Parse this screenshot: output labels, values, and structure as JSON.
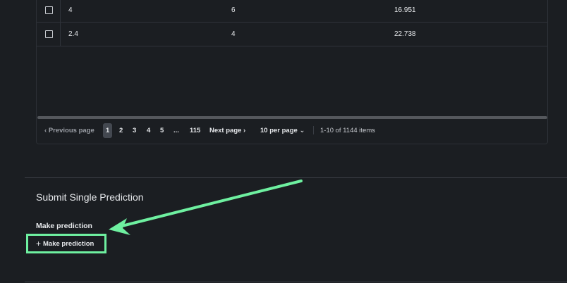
{
  "table": {
    "rows": [
      [
        "4",
        "6",
        "16.951"
      ],
      [
        "2.4",
        "4",
        "22.738"
      ]
    ]
  },
  "pagination": {
    "previous": "Previous page",
    "pages": [
      "1",
      "2",
      "3",
      "4",
      "5",
      "...",
      "115"
    ],
    "current": "1",
    "next": "Next page",
    "per_page": "10 per page",
    "range": "1-10 of 1144 items"
  },
  "section": {
    "title": "Submit Single Prediction",
    "field_label": "Make prediction",
    "button_label": "Make prediction"
  },
  "annotation": {
    "color": "#6ef0a0"
  }
}
